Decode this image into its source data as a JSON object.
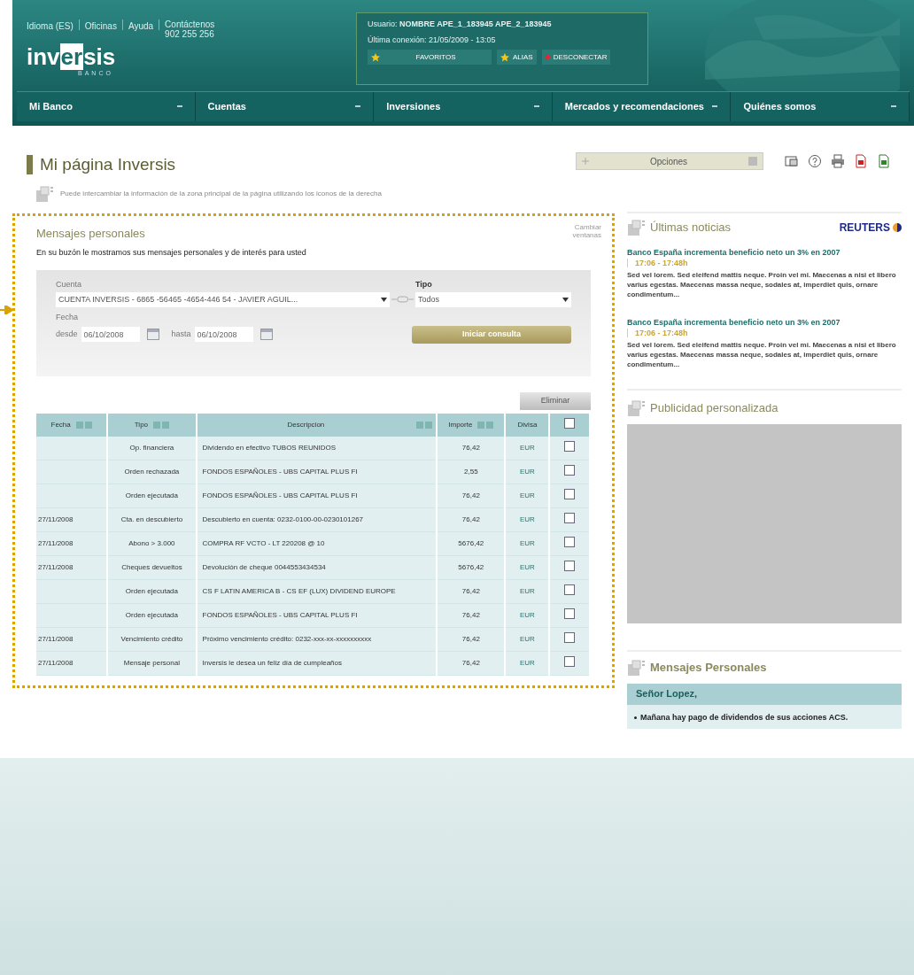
{
  "header": {
    "top_links": [
      "Idioma (ES)",
      "Oficinas",
      "Ayuda",
      "Contáctenos"
    ],
    "phone": "902 255 256",
    "logo": {
      "before": "inv",
      "highlight": "er",
      "after": "sis",
      "sub": "BANCO"
    },
    "user": {
      "label": "Usuario:",
      "name": "NOMBRE APE_1_183945 APE_2_183945",
      "last_login": "Última conexión: 21/05/2009 - 13:05",
      "buttons": [
        {
          "label": "FAVORITOS",
          "kind": "star"
        },
        {
          "label": "ALIAS",
          "kind": "star"
        },
        {
          "label": "DESCONECTAR",
          "kind": "dot"
        }
      ]
    }
  },
  "nav": [
    "Mi Banco",
    "Cuentas",
    "Inversiones",
    "Mercados y recomendaciones",
    "Quiénes somos"
  ],
  "page": {
    "title": "Mi página Inversis",
    "options": "Opciones",
    "hint": "Puede intercambiar la información de la zona principal de la página utilizando los iconos de la derecha"
  },
  "messages": {
    "title": "Mensajes personales",
    "change_windows": "Cambiar ventanas",
    "intro": "En su buzón le mostramos sus mensajes personales y de interés para usted",
    "filter": {
      "account_label": "Cuenta",
      "account": "CUENTA INVERSIS - 6865 -56465 -4654-446 54  -  JAVIER AGUIL...",
      "type_label": "Tipo",
      "type": "Todos",
      "date_label": "Fecha",
      "from_label": "desde",
      "from": "06/10/2008",
      "to_label": "hasta",
      "to": "06/10/2008",
      "query_button": "Iniciar consulta"
    },
    "delete_button": "Eliminar",
    "table": {
      "columns": [
        {
          "label": "Fecha",
          "sortable": true
        },
        {
          "label": "Tipo",
          "sortable": true
        },
        {
          "label": "Descripcion",
          "sortable": true
        },
        {
          "label": "Importe",
          "sortable": true
        },
        {
          "label": "Divisa",
          "sortable": false
        }
      ],
      "all_checked": false,
      "rows": [
        {
          "date": "",
          "type": "Op. financiera",
          "description": "Dividendo en efectivo   TUBOS REUNIDOS",
          "amount": "76,42",
          "currency": "EUR",
          "checked": false
        },
        {
          "date": "",
          "type": "Orden rechazada",
          "description": "FONDOS ESPAÑOLES - UBS CAPITAL PLUS FI",
          "amount": "2,55",
          "currency": "EUR",
          "checked": false
        },
        {
          "date": "",
          "type": "Orden ejecutada",
          "description": "FONDOS ESPAÑOLES - UBS CAPITAL PLUS FI",
          "amount": "76,42",
          "currency": "EUR",
          "checked": false
        },
        {
          "date": "27/11/2008",
          "type": "Cta. en descubierto",
          "description": "Descubierto en cuenta: 0232-0100-00-0230101267",
          "amount": "76,42",
          "currency": "EUR",
          "checked": false
        },
        {
          "date": "27/11/2008",
          "type": "Abono > 3.000",
          "description": "COMPRA RF VCTO - LT 220208 @ 10",
          "amount": "5676,42",
          "currency": "EUR",
          "checked": false
        },
        {
          "date": "27/11/2008",
          "type": "Cheques devueltos",
          "description": "Devolución de cheque 0044553434534",
          "amount": "5676,42",
          "currency": "EUR",
          "checked": false
        },
        {
          "date": "",
          "type": "Orden ejecutada",
          "description": "CS F LATIN AMERICA B - CS EF (LUX) DIVIDEND EUROPE",
          "amount": "76,42",
          "currency": "EUR",
          "checked": false
        },
        {
          "date": "",
          "type": "Orden ejecutada",
          "description": "FONDOS ESPAÑOLES - UBS CAPITAL PLUS FI",
          "amount": "76,42",
          "currency": "EUR",
          "checked": false
        },
        {
          "date": "27/11/2008",
          "type": "Vencimiento crédito",
          "description": "Próximo vencimiento crédito: 0232-xxx-xx-xxxxxxxxxx",
          "amount": "76,42",
          "currency": "EUR",
          "checked": false
        },
        {
          "date": "27/11/2008",
          "type": "Mensaje personal",
          "description": "Inversis le desea un feliz día de cumpleaños",
          "amount": "76,42",
          "currency": "EUR",
          "checked": false
        }
      ]
    }
  },
  "news": {
    "title": "Últimas noticias",
    "source": "REUTERS",
    "items": [
      {
        "headline": "Banco España incrementa beneficio neto un 3% en 2007",
        "time": "17:06 - 17:48h",
        "body": "Sed vel lorem. Sed eleifend mattis neque. Proin vel mi. Maecenas a nisi et libero varius egestas. Maecenas massa neque, sodales at, imperdiet quis, ornare condimentum..."
      },
      {
        "headline": "Banco España incrementa beneficio neto un 3% en 2007",
        "time": "17:06 - 17:48h",
        "body": "Sed vel lorem. Sed eleifend mattis neque. Proin vel mi. Maecenas a nisi et libero varius egestas. Maecenas massa neque, sodales at, imperdiet quis, ornare condimentum..."
      }
    ]
  },
  "ads": {
    "title": "Publicidad personalizada"
  },
  "personal": {
    "title": "Mensajes Personales",
    "greeting": "Señor Lopez,",
    "bullets": [
      "Mañana hay pago de dividendos de sus acciones ACS."
    ]
  }
}
